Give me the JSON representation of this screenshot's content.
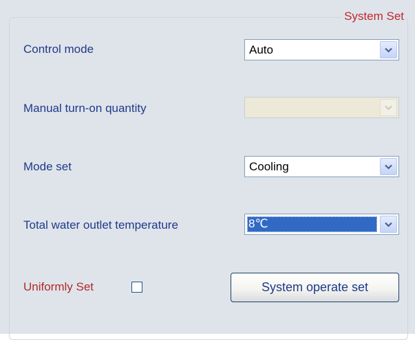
{
  "group": {
    "title": "System Set"
  },
  "rows": {
    "control_mode": {
      "label": "Control mode",
      "value": "Auto"
    },
    "manual_quantity": {
      "label": "Manual turn-on quantity",
      "value": ""
    },
    "mode_set": {
      "label": "Mode set",
      "value": "Cooling"
    },
    "water_temp": {
      "label": "Total water outlet temperature",
      "value": "8℃"
    }
  },
  "uniformly": {
    "label": "Uniformly Set",
    "checked": false
  },
  "button": {
    "label": "System operate set"
  },
  "colors": {
    "panel_bg": "#dfe4ea",
    "label_blue": "#1f3a8a",
    "accent_red": "#c0282e",
    "selection_blue": "#316ac5"
  },
  "icons": {
    "dropdown": "chevron-down-icon"
  }
}
